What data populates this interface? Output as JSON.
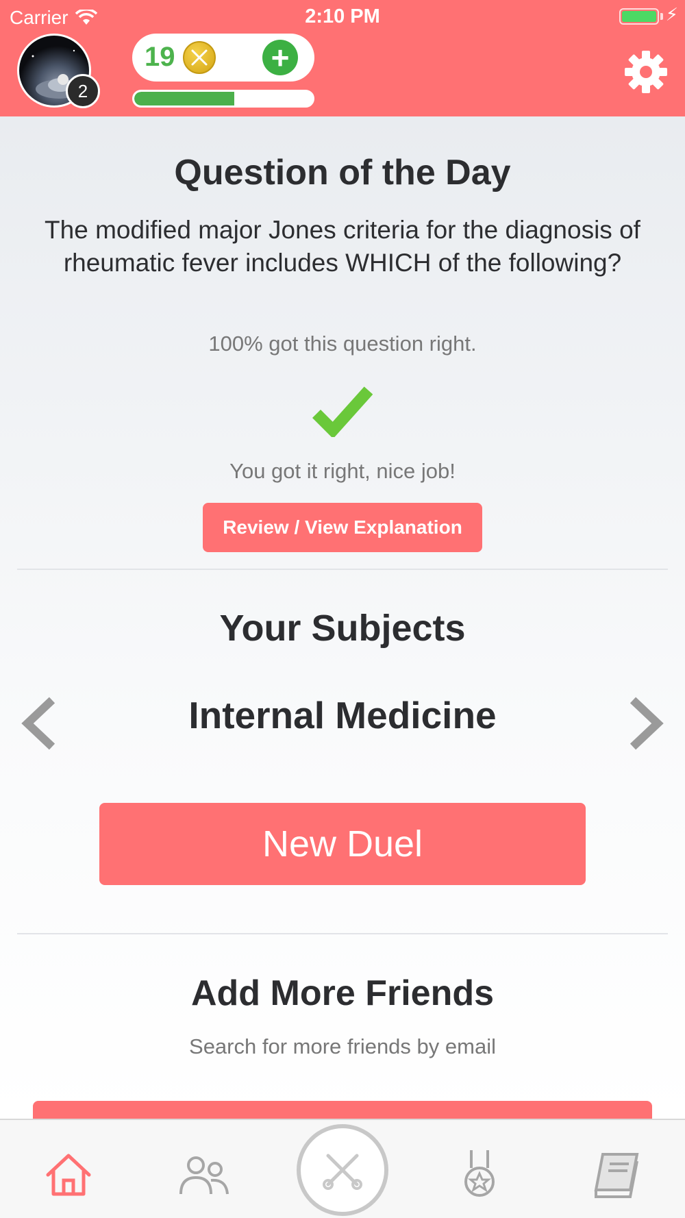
{
  "status_bar": {
    "carrier": "Carrier",
    "time": "2:10 PM"
  },
  "profile": {
    "level_badge": "2"
  },
  "wallet": {
    "coins": "19",
    "xp_progress": 0.56
  },
  "qotd": {
    "title": "Question of the Day",
    "question": "The modified major Jones criteria for the diagnosis of rheumatic fever includes WHICH of the following?",
    "percent_correct": "100% got this question right.",
    "result": "You got it right, nice job!",
    "review_button": "Review / View Explanation"
  },
  "subjects": {
    "title": "Your Subjects",
    "current": "Internal Medicine",
    "new_duel_button": "New Duel"
  },
  "friends": {
    "title": "Add More Friends",
    "subtitle": "Search for more friends by email"
  },
  "tabs": [
    "home",
    "friends",
    "duel",
    "achievements",
    "library"
  ],
  "colors": {
    "accent": "#ff7173",
    "success": "#4cb04c",
    "check": "#6ac83a"
  }
}
